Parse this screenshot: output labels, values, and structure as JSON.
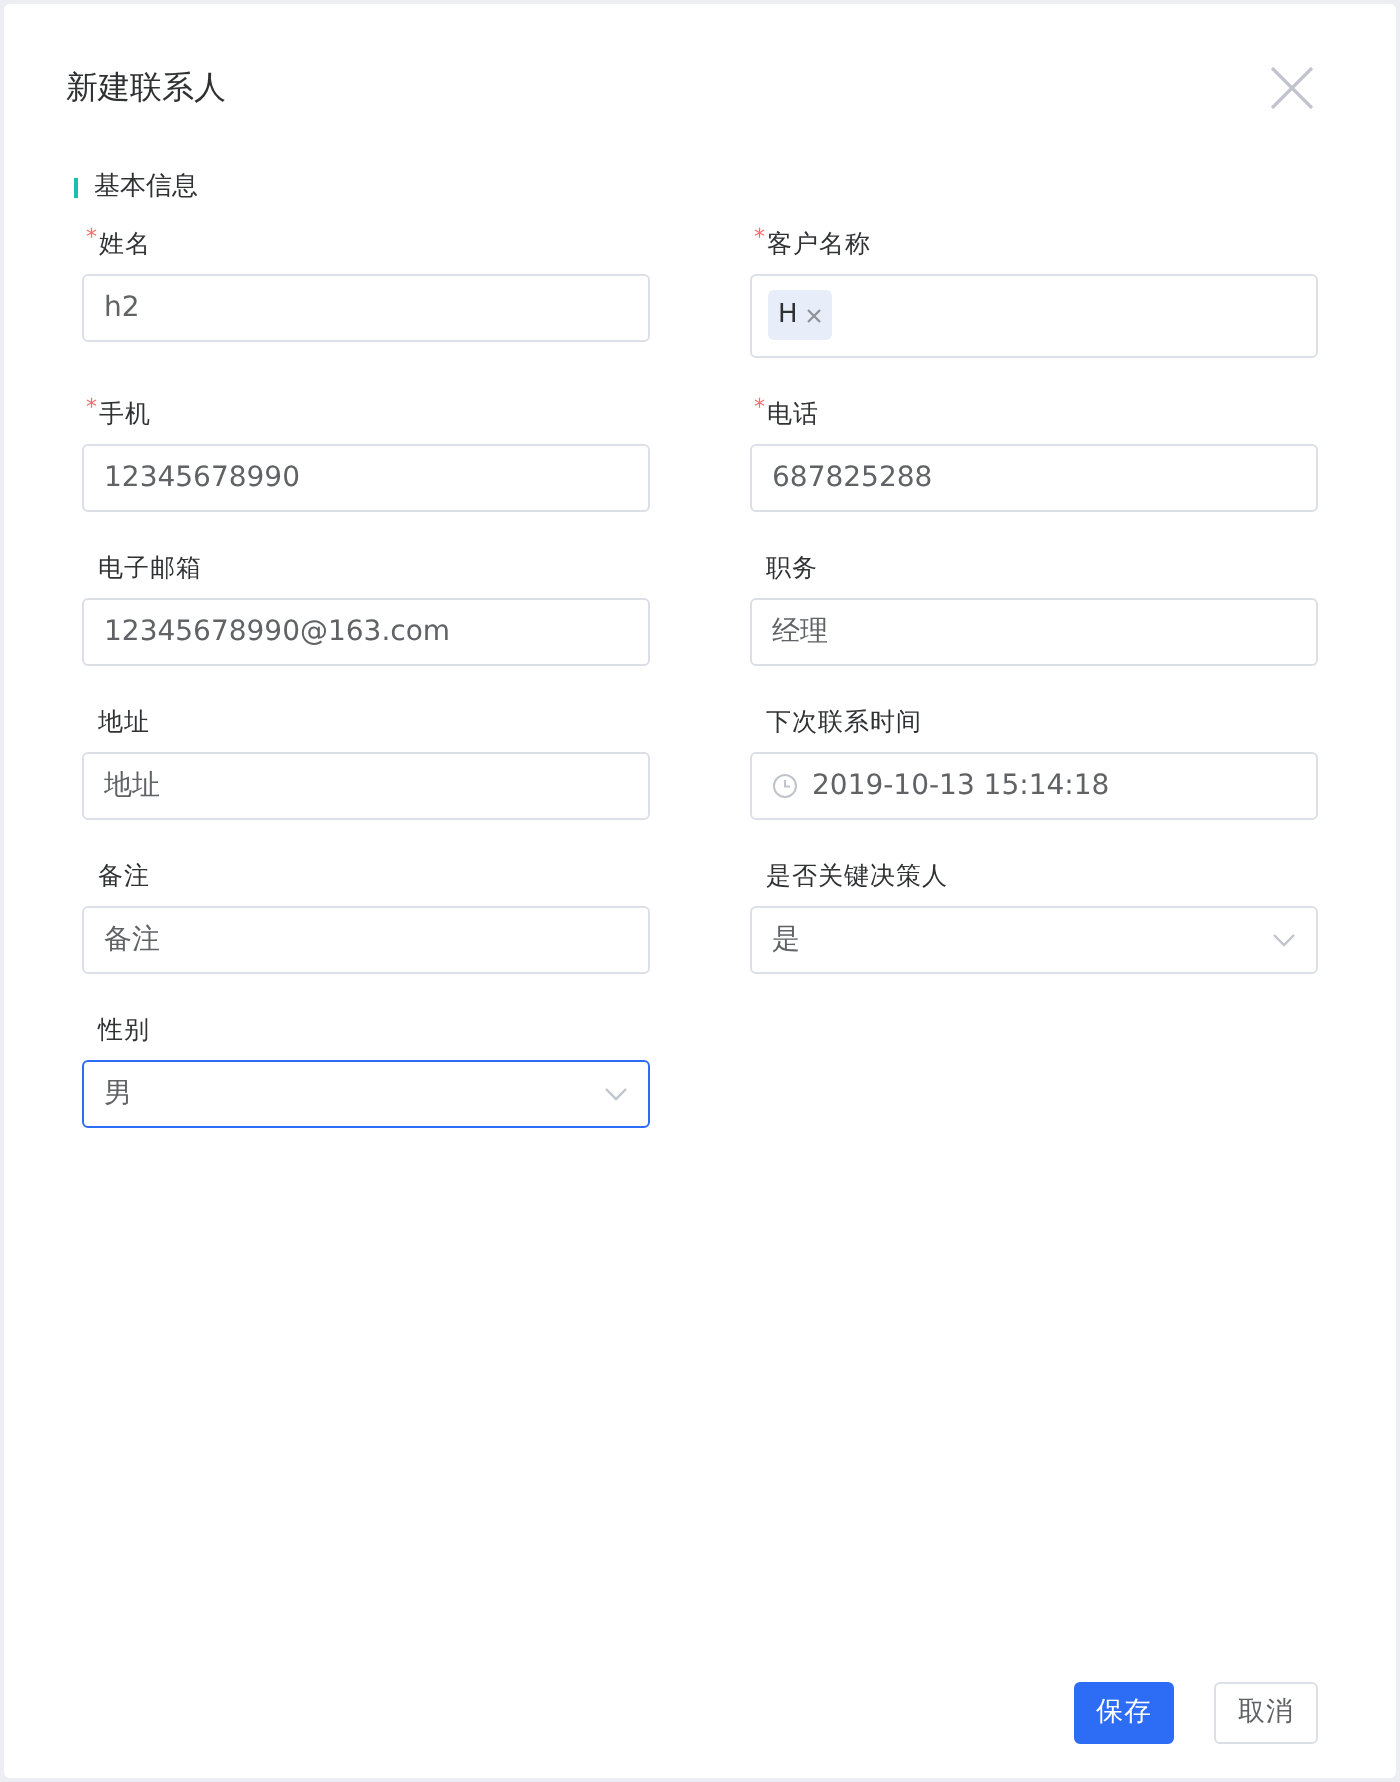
{
  "dialog": {
    "title": "新建联系人"
  },
  "section": {
    "title": "基本信息"
  },
  "fields": [
    {
      "kind": "text",
      "label": "姓名",
      "required_mark": "*",
      "value": "h2",
      "focused": false
    },
    {
      "kind": "tags",
      "label": "客户名称",
      "required_mark": "*",
      "tags": [
        "H"
      ],
      "focused": false
    },
    {
      "kind": "text",
      "label": "手机",
      "required_mark": "*",
      "value": "12345678990",
      "focused": false
    },
    {
      "kind": "text",
      "label": "电话",
      "required_mark": "*",
      "value": "687825288",
      "focused": false
    },
    {
      "kind": "text",
      "label": "电子邮箱",
      "value": "12345678990@163.com",
      "focused": false
    },
    {
      "kind": "text",
      "label": "职务",
      "value": "经理",
      "focused": false
    },
    {
      "kind": "text",
      "label": "地址",
      "value": "地址",
      "focused": false
    },
    {
      "kind": "date",
      "label": "下次联系时间",
      "value": "2019-10-13 15:14:18",
      "focused": false
    },
    {
      "kind": "text",
      "label": "备注",
      "value": "备注",
      "focused": false
    },
    {
      "kind": "select",
      "label": "是否关键决策人",
      "value": "是",
      "focused": false
    },
    {
      "kind": "select",
      "label": "性别",
      "value": "男",
      "focused": true
    }
  ],
  "buttons": [
    {
      "label": "保存",
      "kind": "primary"
    },
    {
      "label": "取消",
      "kind": "default"
    }
  ]
}
